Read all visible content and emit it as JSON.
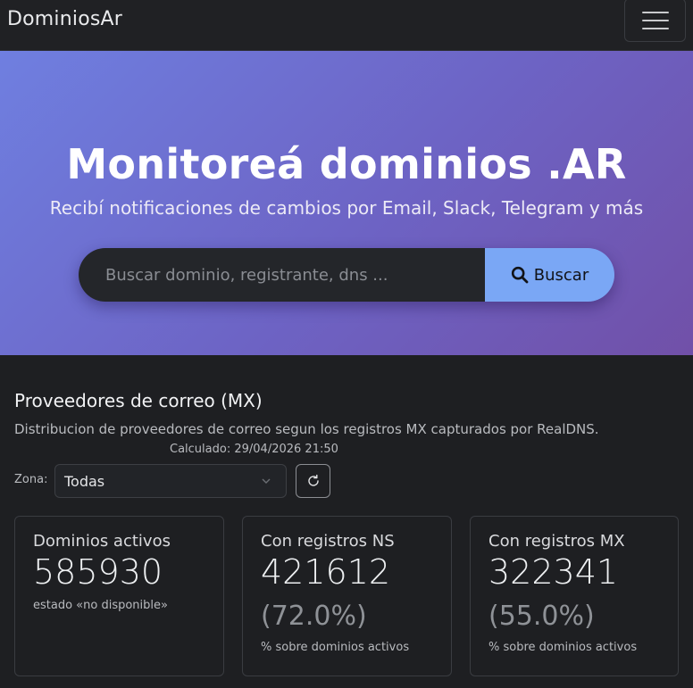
{
  "navbar": {
    "brand": "DominiosAr",
    "menu_icon": "hamburger-menu-icon"
  },
  "hero": {
    "title": "Monitoreá dominios .AR",
    "subtitle": "Recibí notificaciones de cambios por Email, Slack, Telegram y más",
    "search": {
      "placeholder": "Buscar dominio, registrante, dns ...",
      "value": "",
      "button_label": "Buscar",
      "button_icon": "search-icon"
    }
  },
  "section": {
    "title": "Proveedores de correo (MX)",
    "description": "Distribucion de proveedores de correo segun los registros MX capturados por RealDNS.",
    "calculated_label": "Calculado:",
    "calculated_value": "29/04/2026 21:50",
    "zone_label": "Zona:",
    "zone_selected": "Todas",
    "refresh_icon": "refresh-icon"
  },
  "cards": [
    {
      "title": "Dominios activos",
      "value": "585930",
      "percent": "",
      "note": "estado «no disponible»"
    },
    {
      "title": "Con registros NS",
      "value": "421612",
      "percent": "(72.0%)",
      "note": "% sobre dominios activos"
    },
    {
      "title": "Con registros MX",
      "value": "322341",
      "percent": "(55.0%)",
      "note": "% sobre dominios activos"
    }
  ],
  "colors": {
    "page_bg": "#1e1f22",
    "hero_gradient_start": "#6f7fe0",
    "hero_gradient_end": "#7150a8",
    "search_button_bg": "#7aa7f5"
  }
}
